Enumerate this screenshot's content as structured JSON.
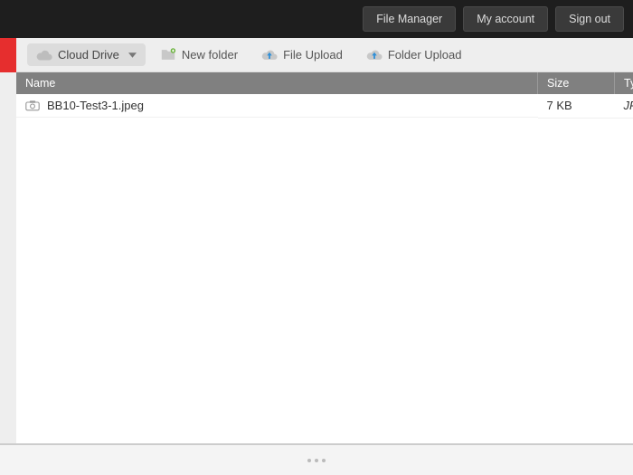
{
  "topbar": {
    "file_manager": "File Manager",
    "my_account": "My account",
    "sign_out": "Sign out"
  },
  "toolbar": {
    "cloud_drive": "Cloud Drive",
    "new_folder": "New folder",
    "file_upload": "File Upload",
    "folder_upload": "Folder Upload"
  },
  "table": {
    "headers": {
      "name": "Name",
      "size": "Size",
      "type": "Type"
    },
    "rows": [
      {
        "name": "BB10-Test3-1.jpeg",
        "size": "7 KB",
        "type": "JPEG"
      }
    ]
  }
}
